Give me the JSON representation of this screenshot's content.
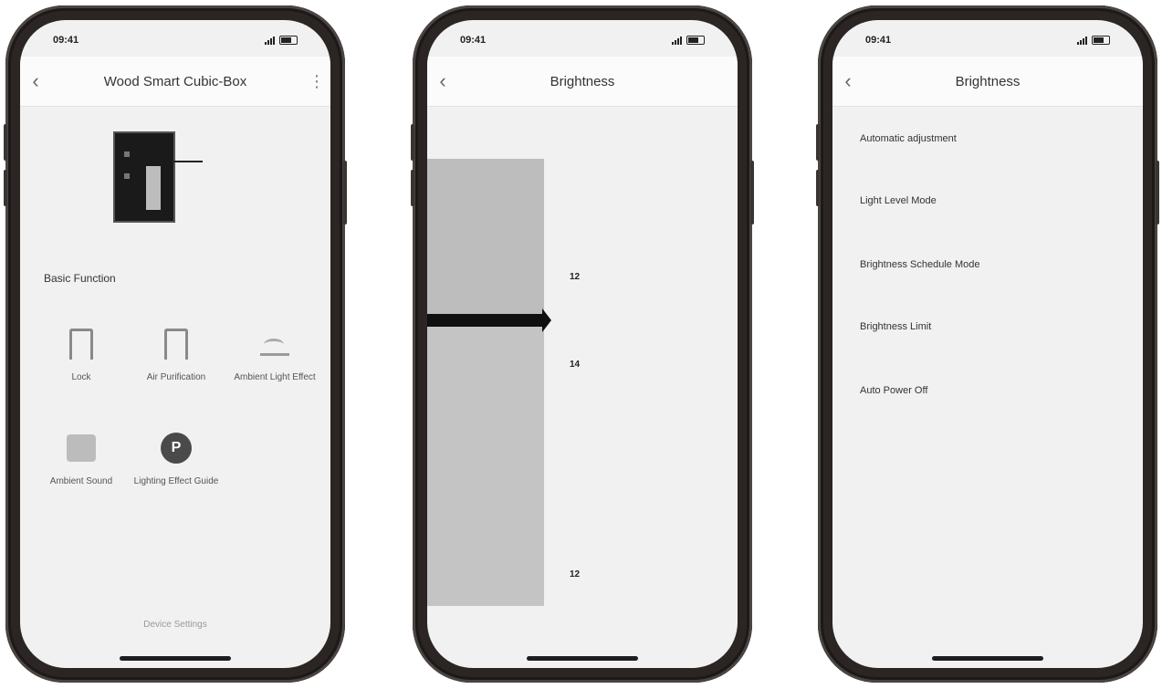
{
  "colors": {
    "phone_frame": "#2b2624",
    "screen_bg": "#f1f1f1",
    "gauge_fill": "#c4c4c4",
    "marker": "#101010"
  },
  "screens": [
    {
      "status": {
        "time": "09:41",
        "carrier": ""
      },
      "nav": {
        "title": "Wood Smart Cubic-Box",
        "back_icon": "chevron-left-icon",
        "more_icon": "more-icon"
      },
      "section_title": "Basic Function",
      "functions": [
        {
          "label": "Lock",
          "icon": "door-icon"
        },
        {
          "label": "Air Purification",
          "icon": "door-icon"
        },
        {
          "label": "Ambient Light Effect",
          "icon": "wave-icon"
        },
        {
          "label": "Ambient Sound",
          "icon": "square-icon"
        },
        {
          "label": "Lighting Effect Guide",
          "icon": "circle-icon",
          "glyph": "P"
        }
      ],
      "footer": "Device Settings"
    },
    {
      "status": {
        "time": "09:41",
        "carrier": ""
      },
      "nav": {
        "title": "Brightness",
        "back_icon": "chevron-left-icon"
      },
      "ticks": [
        "12",
        "14",
        "12"
      ]
    },
    {
      "status": {
        "time": "09:41",
        "carrier": ""
      },
      "nav": {
        "title": "Brightness",
        "back_icon": "chevron-left-icon"
      },
      "settings": [
        "Automatic adjustment",
        "Light Level Mode",
        "Brightness Schedule Mode",
        "Brightness Limit",
        "Auto Power Off"
      ]
    }
  ]
}
